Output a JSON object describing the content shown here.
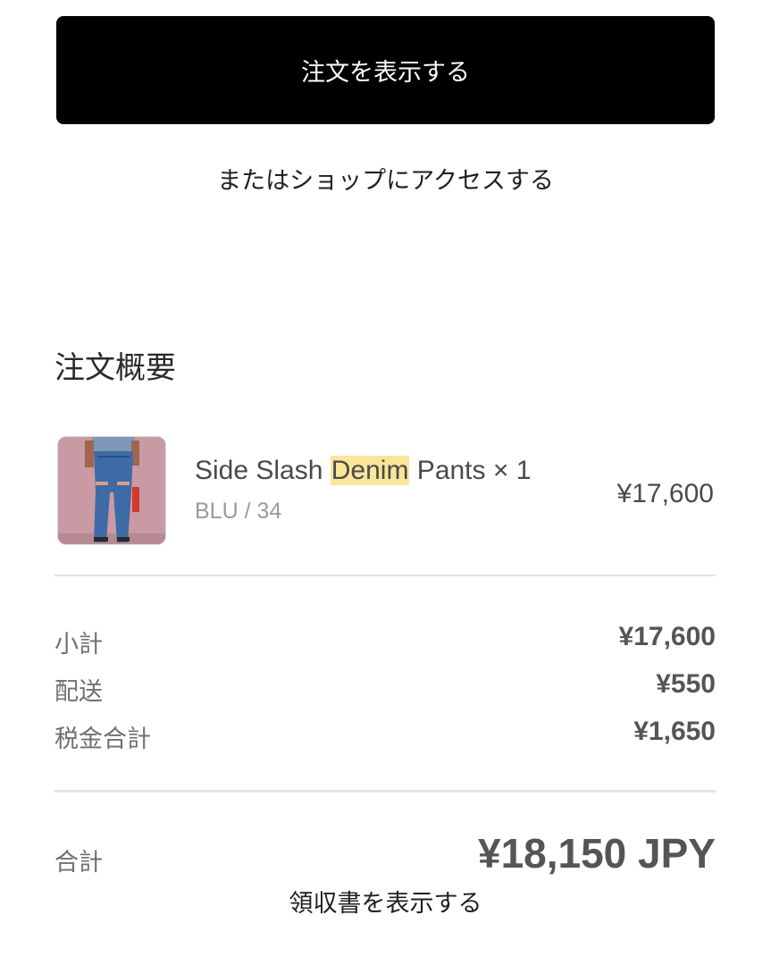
{
  "view_order_button": "注文を表示する",
  "shop_link": "またはショップにアクセスする",
  "summary": {
    "title": "注文概要",
    "item": {
      "name_before": "Side Slash ",
      "name_highlight": "Denim",
      "name_after": " Pants × 1",
      "variant": "BLU / 34",
      "price": "¥17,600"
    },
    "rows": [
      {
        "label": "小計",
        "value": "¥17,600"
      },
      {
        "label": "配送",
        "value": "¥550"
      },
      {
        "label": "税金合計",
        "value": "¥1,650"
      }
    ],
    "total_label": "合計",
    "total_value": "¥18,150 JPY"
  },
  "receipt_link": "領収書を表示する",
  "colors": {
    "button_bg": "#000000",
    "highlight": "#fbe59a"
  }
}
